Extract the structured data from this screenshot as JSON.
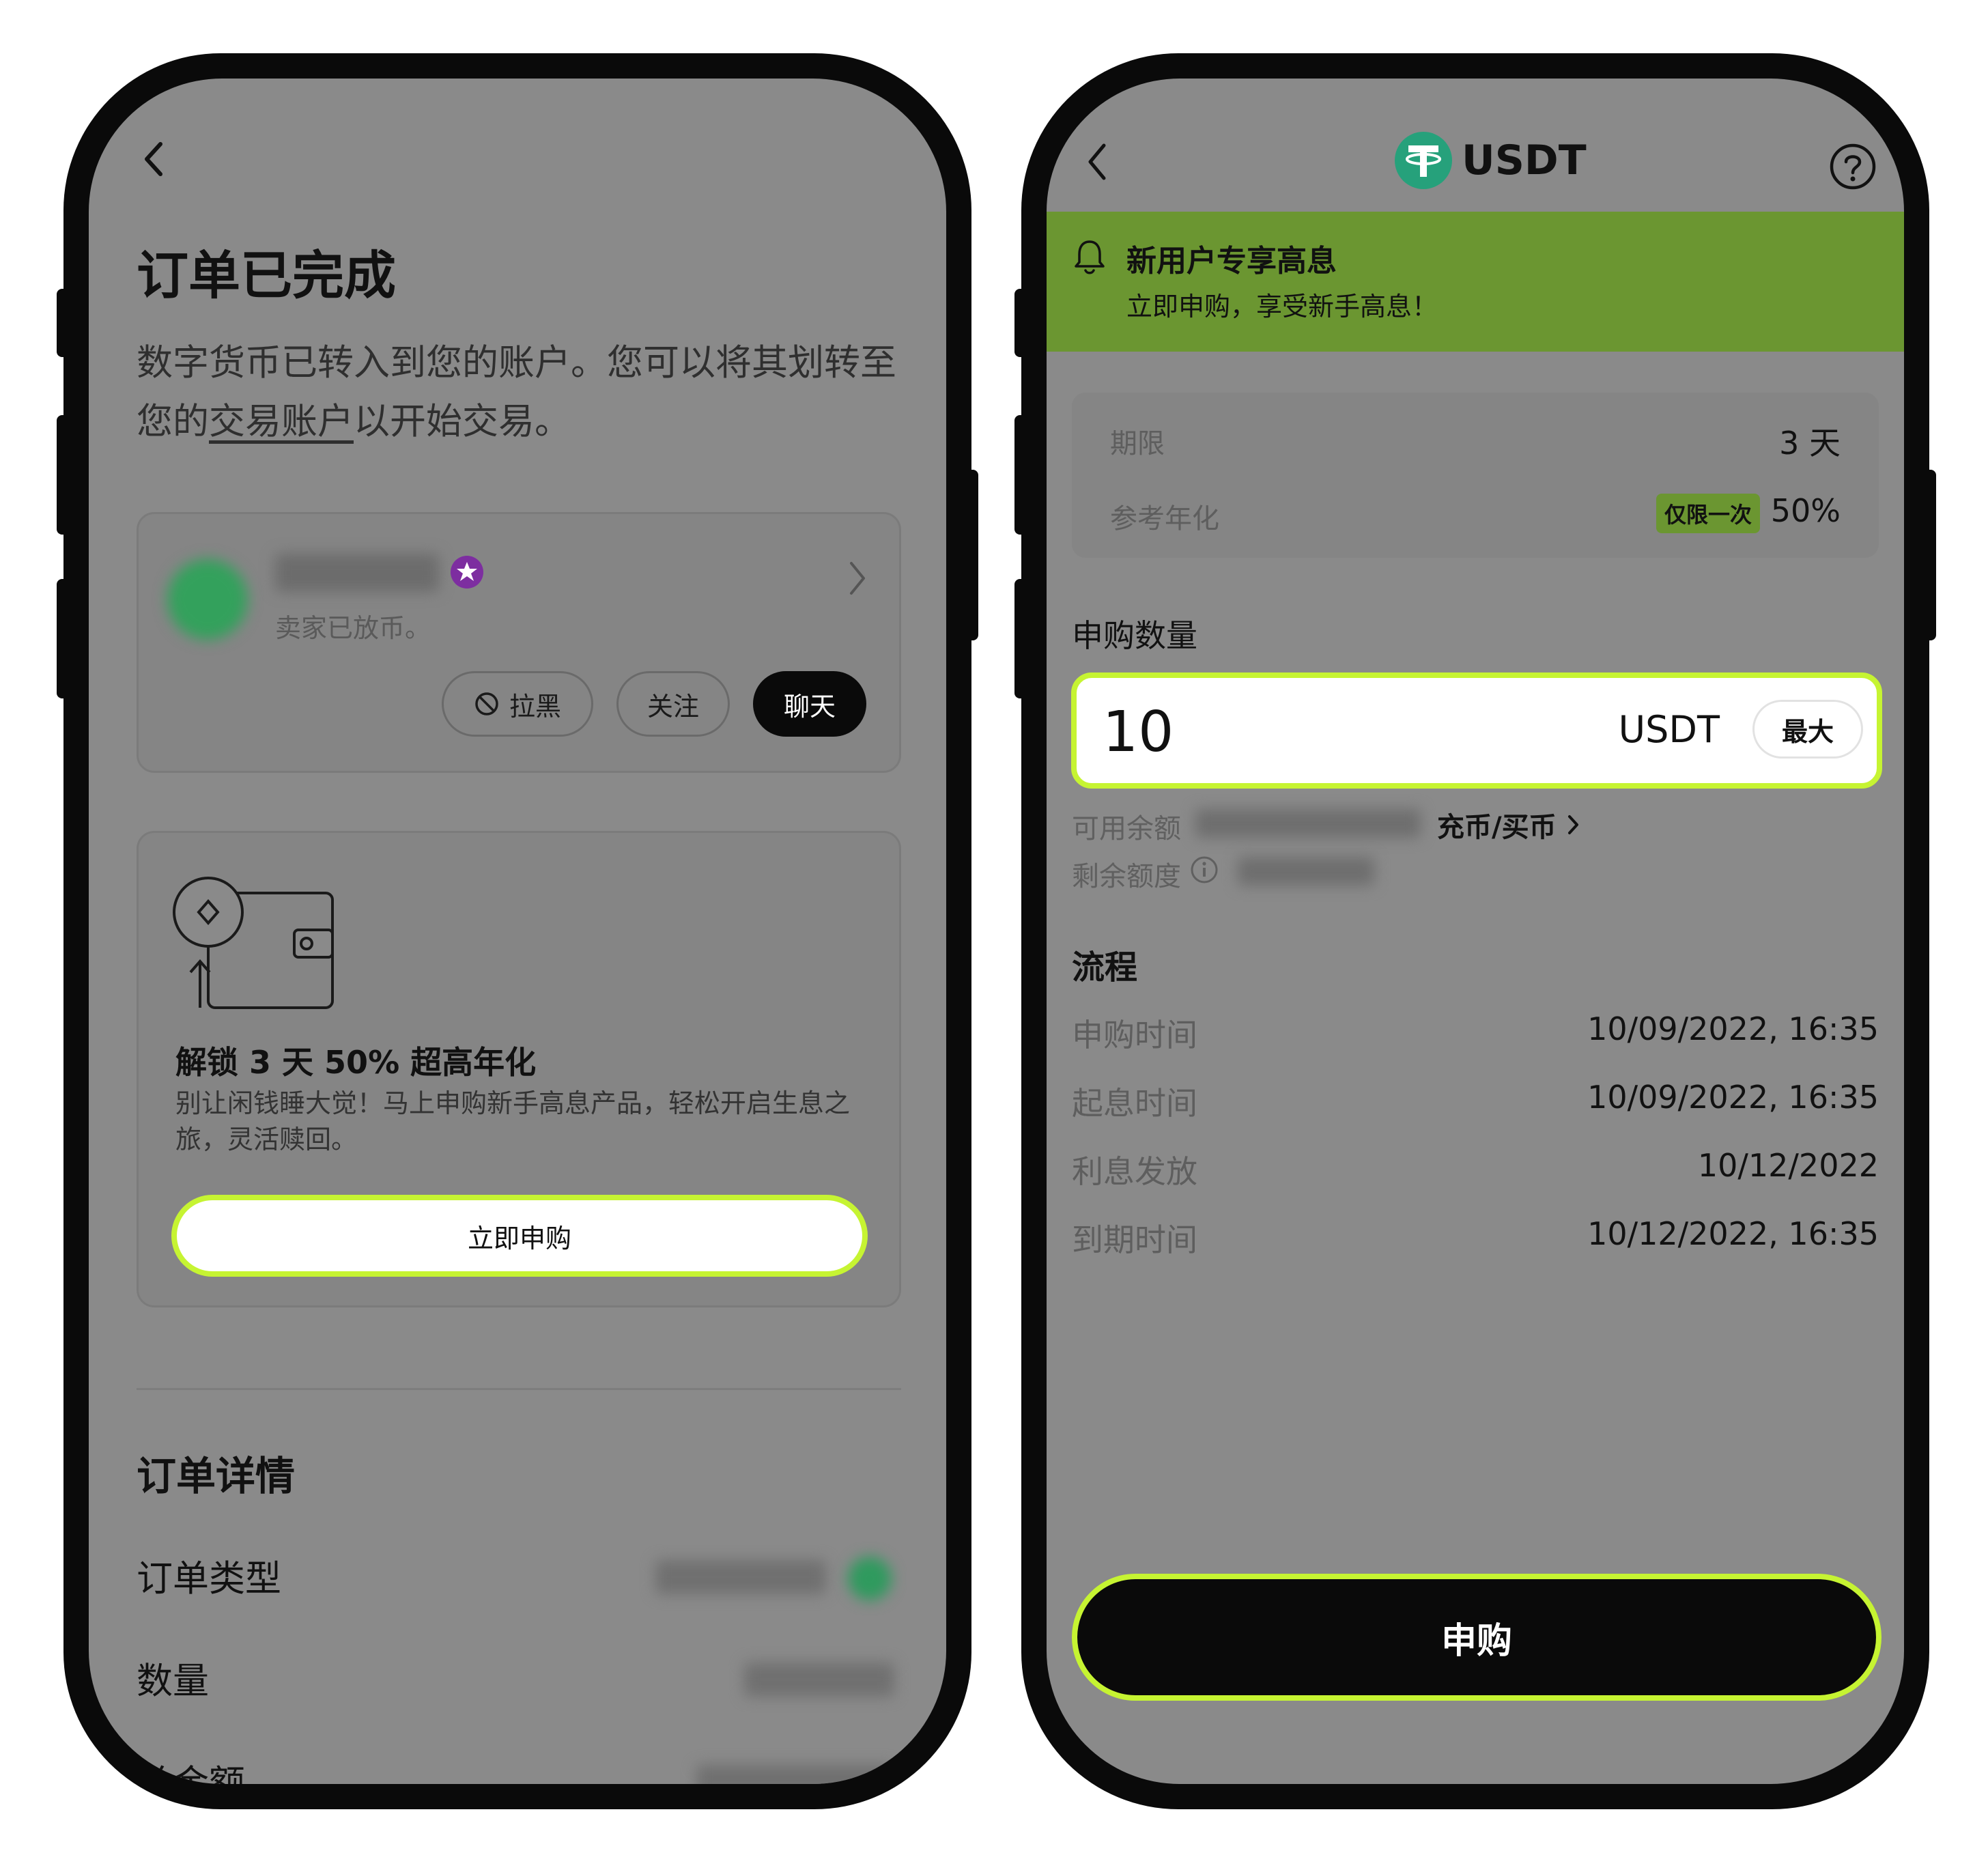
{
  "left_screen": {
    "page_title": "订单已完成",
    "description_part1": "数字货币已转入到您的账户。您可以将其划转至您的",
    "description_link": "交易账户",
    "description_part2": "以开始交易。",
    "seller": {
      "status": "卖家已放币。",
      "block_label": "拉黑",
      "follow_label": "关注",
      "chat_label": "聊天"
    },
    "promo": {
      "title": "解锁 3 天 50% 超高年化",
      "description": "别让闲钱睡大觉！马上申购新手高息产品，轻松开启生息之旅，灵活赎回。",
      "button_label": "立即申购"
    },
    "order_details": {
      "title": "订单详情",
      "rows": [
        {
          "label": "订单类型"
        },
        {
          "label": "数量"
        },
        {
          "label": "总金额"
        }
      ]
    }
  },
  "right_screen": {
    "header": {
      "title": "USDT"
    },
    "banner": {
      "title": "新用户专享高息",
      "subtitle": "立即申购，享受新手高息！"
    },
    "info": {
      "term_label": "期限",
      "term_value": "3 天",
      "apy_label": "参考年化",
      "apy_tag": "仅限一次",
      "apy_value": "50%"
    },
    "amount": {
      "label": "申购数量",
      "value": "10",
      "unit": "USDT",
      "max_label": "最大"
    },
    "balance": {
      "available_label": "可用余额",
      "deposit_link": "充币/买币",
      "remaining_label": "剩余额度"
    },
    "flow": {
      "title": "流程",
      "rows": [
        {
          "label": "申购时间",
          "value": "10/09/2022, 16:35"
        },
        {
          "label": "起息时间",
          "value": "10/09/2022, 16:35"
        },
        {
          "label": "利息发放",
          "value": "10/12/2022"
        },
        {
          "label": "到期时间",
          "value": "10/12/2022, 16:35"
        }
      ]
    },
    "submit_label": "申购"
  },
  "colors": {
    "screen_bg": "#8a8a8a",
    "accent_lime": "#c6f432",
    "banner_green": "#6b9631",
    "tether_green": "#26a17b",
    "phone_frame": "#0a0a0a"
  },
  "icons": [
    "back-arrow-icon",
    "chevron-right-icon",
    "verified-badge-icon",
    "block-icon",
    "wallet-coin-icon",
    "tether-logo-icon",
    "help-icon",
    "bell-icon",
    "info-icon"
  ]
}
